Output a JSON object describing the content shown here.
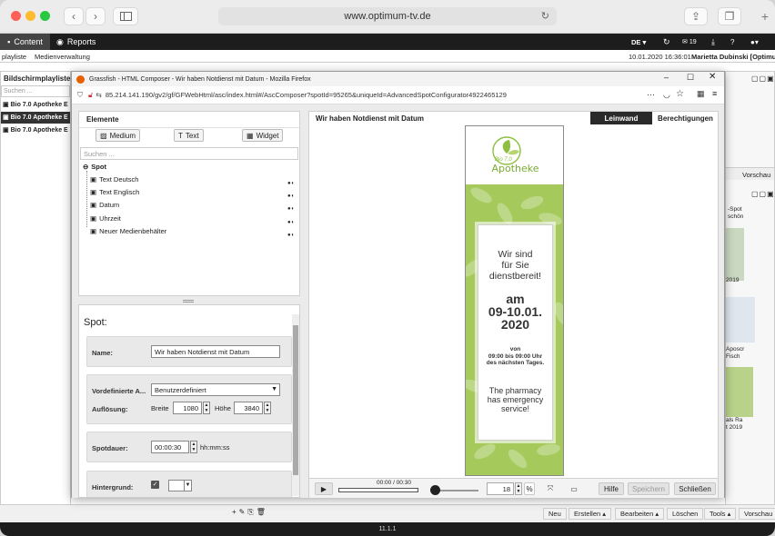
{
  "browser": {
    "url": "www.optimum-tv.de"
  },
  "app": {
    "tab_content": "Content",
    "tab_reports": "Reports",
    "language": "DE",
    "mail_count": "19",
    "subtabs": [
      "playliste",
      "Medienverwaltung"
    ],
    "datetime": "10.01.2020 16:36:01",
    "user": "Marietta Dubinski [Optimu",
    "version": "11.1.1"
  },
  "background": {
    "left_header": "Bildschirmplaylisten",
    "left_search": "Suchen ...",
    "left_items": [
      "Bio 7.0 Apotheke E",
      "Bio 7.0 Apotheke E",
      "Bio 7.0 Apotheke E"
    ],
    "right_texts": [
      "-Spot",
      "schön",
      "2019",
      "Aposcr",
      "Fisch",
      "als Ra",
      "t 2019"
    ],
    "vorschau": "Vorschau",
    "bottom_buttons": [
      "Neu",
      "Erstellen ▴",
      "Bearbeiten ▴",
      "Löschen",
      "Tools ▴",
      "Vorschau"
    ]
  },
  "firefox": {
    "title": "Grassfish - HTML Composer - Wir haben Notdienst mit Datum - Mozilla Firefox",
    "url": "85.214.141.190/gv2/gf/GFWebHtml/asc/index.html#/AscComposer?spotId=95265&uniqueId=AdvancedSpotConfigurator4922465129"
  },
  "composer": {
    "elements_header": "Elemente",
    "btn_medium": "Medium",
    "btn_text": "Text",
    "btn_widget": "Widget",
    "search_placeholder": "Suchen ...",
    "tree_root": "Spot",
    "tree_items": [
      "Text Deutsch",
      "Text Englisch",
      "Datum",
      "Uhrzeit",
      "Neuer Medienbehälter"
    ],
    "props_title": "Spot:",
    "name_label": "Name:",
    "name_value": "Wir haben Notdienst mit Datum",
    "preset_label": "Vordefinierte A...",
    "preset_value": "Benutzerdefiniert",
    "resolution_label": "Auflösung:",
    "width_label": "Breite",
    "width_value": "1080",
    "height_label": "Höhe",
    "height_value": "3840",
    "duration_label": "Spotdauer:",
    "duration_value": "00:00:30",
    "duration_unit": "hh:mm:ss",
    "background_label": "Hintergrund:",
    "canvas_title": "Wir haben Notdienst mit Datum",
    "tab_canvas": "Leinwand",
    "tab_permissions": "Berechtigungen",
    "time_display": "00:00 / 00:30",
    "zoom_value": "18",
    "zoom_unit": "%",
    "btn_help": "Hilfe",
    "btn_save": "Speichern",
    "btn_close": "Schließen"
  },
  "poster": {
    "brand_small": "Bio 7.0",
    "brand": "Apotheke",
    "line1": "Wir sind",
    "line2": "für Sie",
    "line3": "dienstbereit!",
    "am": "am",
    "date": "09-10.01.",
    "year": "2020",
    "von": "von",
    "hours": "09:00 bis 09:00 Uhr",
    "next_day": "des nächsten Tages.",
    "en1": "The pharmacy",
    "en2": "has emergency",
    "en3": "service!"
  }
}
